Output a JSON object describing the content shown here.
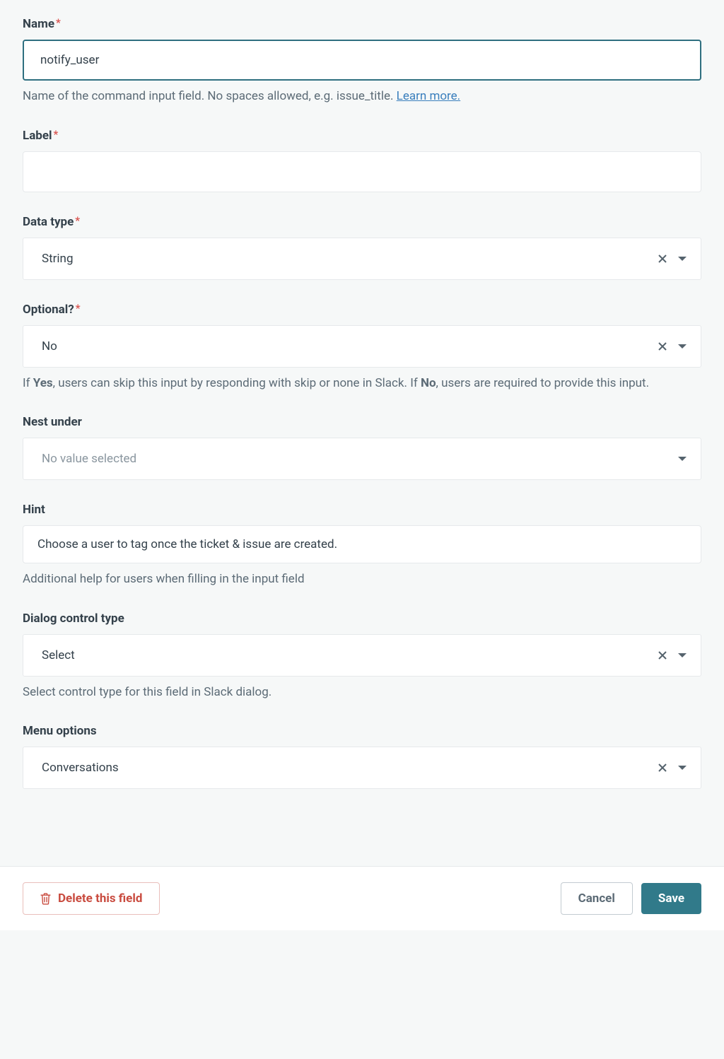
{
  "fields": {
    "name": {
      "label": "Name",
      "required": true,
      "value": "notify_user",
      "help_prefix": "Name of the command input field. No spaces allowed, e.g. issue_title. ",
      "help_link_text": "Learn more."
    },
    "label": {
      "label": "Label",
      "required": true,
      "value": ""
    },
    "data_type": {
      "label": "Data type",
      "required": true,
      "value": "String"
    },
    "optional": {
      "label": "Optional?",
      "required": true,
      "value": "No",
      "help_p1": "If ",
      "help_b1": "Yes",
      "help_p2": ", users can skip this input by responding with skip or none in Slack. If ",
      "help_b2": "No",
      "help_p3": ", users are required to provide this input."
    },
    "nest_under": {
      "label": "Nest under",
      "placeholder": "No value selected"
    },
    "hint": {
      "label": "Hint",
      "value": "Choose a user to tag once the ticket & issue are created.",
      "help": "Additional help for users when filling in the input field"
    },
    "dialog_control_type": {
      "label": "Dialog control type",
      "value": "Select",
      "help": "Select control type for this field in Slack dialog."
    },
    "menu_options": {
      "label": "Menu options",
      "value": "Conversations"
    }
  },
  "footer": {
    "delete_label": "Delete this field",
    "cancel_label": "Cancel",
    "save_label": "Save"
  }
}
